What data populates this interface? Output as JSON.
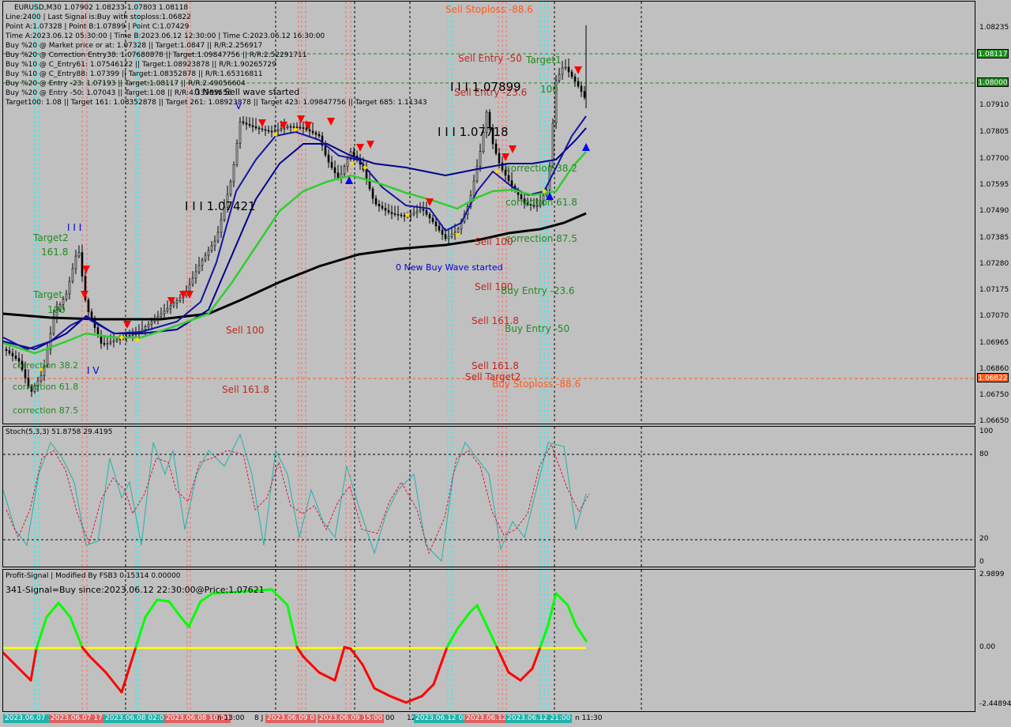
{
  "colors": {
    "background": "#c0c0c0",
    "buy_green": "#1e8c1e",
    "sell_red": "#c0281e",
    "stoploss_orange": "#ff5a1e",
    "blue": "#0000cd",
    "navy": "#00008b",
    "ma_green": "#32cd32",
    "stoch_main": "#20b2aa",
    "stoch_signal": "#dc143c",
    "profit_up": "#00ff00",
    "profit_down": "#ff0000",
    "zero_line": "#ffff00",
    "cyan_marker": "#00ffff"
  },
  "header": {
    "symbol": "EURUSD,M30  1.07902 1.08233 1.07803 1.08118",
    "lines": [
      "Line:2400 | Last Signal is:Buy with stoploss:1.06822",
      "Point A:1.07328 | Point B:1.07899 | Point C:1.07429",
      "Time A:2023.06.12 05:30:00 | Time B:2023.06.12 12:30:00 | Time C:2023.06.12 16:30:00",
      "Buy %20 @ Market price or at: 1.07328 || Target:1.0847 || R/R:2.256917",
      "Buy %20 @ Correction Entry38: 1.07680878 || Target:1.09847756 || R/R:2.52291711",
      "Buy %10 @ C_Entry61: 1.07546122 || Target:1.08923878 || R/R:1.90265729",
      "Buy %10 @ C_Entry88: 1.07399 || Target:1.08352878 || R/R:1.65316811",
      "Buy %20 @ Entry -23: 1.07193 || Target:1.08117 || R/R:2.49056604",
      "Buy %20 @ Entry -50: 1.07043 || Target:1.08 || R/R:4.33955556",
      "Target100: 1.08 || Target 161: 1.08352878 || Target 261: 1.08923878 || Target 423: 1.09847756 || Target 685: 1.11343"
    ]
  },
  "price_axis": [
    "1.08235",
    "1.08117",
    "1.08000",
    "1.07910",
    "1.07805",
    "1.07700",
    "1.07595",
    "1.07490",
    "1.07385",
    "1.07280",
    "1.07175",
    "1.07070",
    "1.06965",
    "1.06860",
    "1.06822",
    "1.06750",
    "1.06650"
  ],
  "price_boxes": [
    {
      "label": "1.08117",
      "color": "#1e8c1e"
    },
    {
      "label": "1.08000",
      "color": "#1e8c1e"
    },
    {
      "label": "1.06822",
      "color": "#ff5a1e"
    }
  ],
  "main_labels": {
    "sell_stoploss_top": "Sell Stoploss -88.6",
    "sell_entry_50": "Sell Entry -50",
    "sell_entry_23": "Sell Entry -23.6",
    "target1": "Target1",
    "t100_top": "100",
    "level_07899": "I I I 1.07899",
    "level_07718": "I I I 1.07718",
    "level_07421": "I I I 1.07421",
    "new_sell_wave": "0 New Sell wave started",
    "correction_382_right": "correction 38.2",
    "correction_618_right": "correction 61.8",
    "correction_875_right": "correction 87.5",
    "sell_100_a": "Sell 100",
    "sell_100_b": "Sell 100",
    "sell_100_left": "Sell 100",
    "new_buy_wave": "0 New Buy Wave started",
    "buy_entry_23": "Buy Entry -23.6",
    "sell_1618_a": "Sell 161.8",
    "buy_entry_50": "Buy Entry -50",
    "sell_1618_b": "Sell 161.8",
    "sell_target2": "Sell Target2",
    "buy_stoploss": "Buy Stoploss -88.6",
    "sell_1618_left": "Sell 161.8",
    "target2_left": "Target2",
    "t1618_left": "161.8",
    "target_left": "Target",
    "t100_left": "100",
    "correction_382_left": "correction 38.2",
    "correction_618_left": "correction 61.8",
    "correction_875_left": "correction 87.5",
    "wave_iii": "I I I",
    "wave_iv": "I V",
    "wave_v": "V"
  },
  "stoch": {
    "title": "Stoch(5,3,3) 51.8758 29.4195",
    "axis": [
      "100",
      "80",
      "20",
      "0"
    ]
  },
  "profit": {
    "title": "Profit-Signal | Modified By FSB3 0.15314 0.00000",
    "signal": "341-Signal=Buy since:2023.06.12 22:30:00@Price:1.07621",
    "axis": [
      "2.9899",
      "0.00",
      "-2.44894"
    ]
  },
  "time_axis": [
    {
      "label": "2023.06.07 1",
      "boxed": "cyan"
    },
    {
      "label": "2023.06.07 17:",
      "boxed": "red"
    },
    {
      "label": "2023.06.08 02:00",
      "boxed": "cyan"
    },
    {
      "label": "2023.06.08 10:00",
      "boxed": "red"
    },
    {
      "label": "n 13:00",
      "boxed": "none"
    },
    {
      "label": "8 J",
      "boxed": "none"
    },
    {
      "label": "2023.06.09 0",
      "boxed": "red"
    },
    {
      "label": "2023.06.09 15:00",
      "boxed": "red"
    },
    {
      "label": "00",
      "boxed": "none"
    },
    {
      "label": "12",
      "boxed": "none"
    },
    {
      "label": "2023.06.12 08",
      "boxed": "cyan"
    },
    {
      "label": "2023.06.12",
      "boxed": "red"
    },
    {
      "label": "2023.06.12 21:00",
      "boxed": "cyan"
    },
    {
      "label": "n 11:30",
      "boxed": "none"
    }
  ]
}
